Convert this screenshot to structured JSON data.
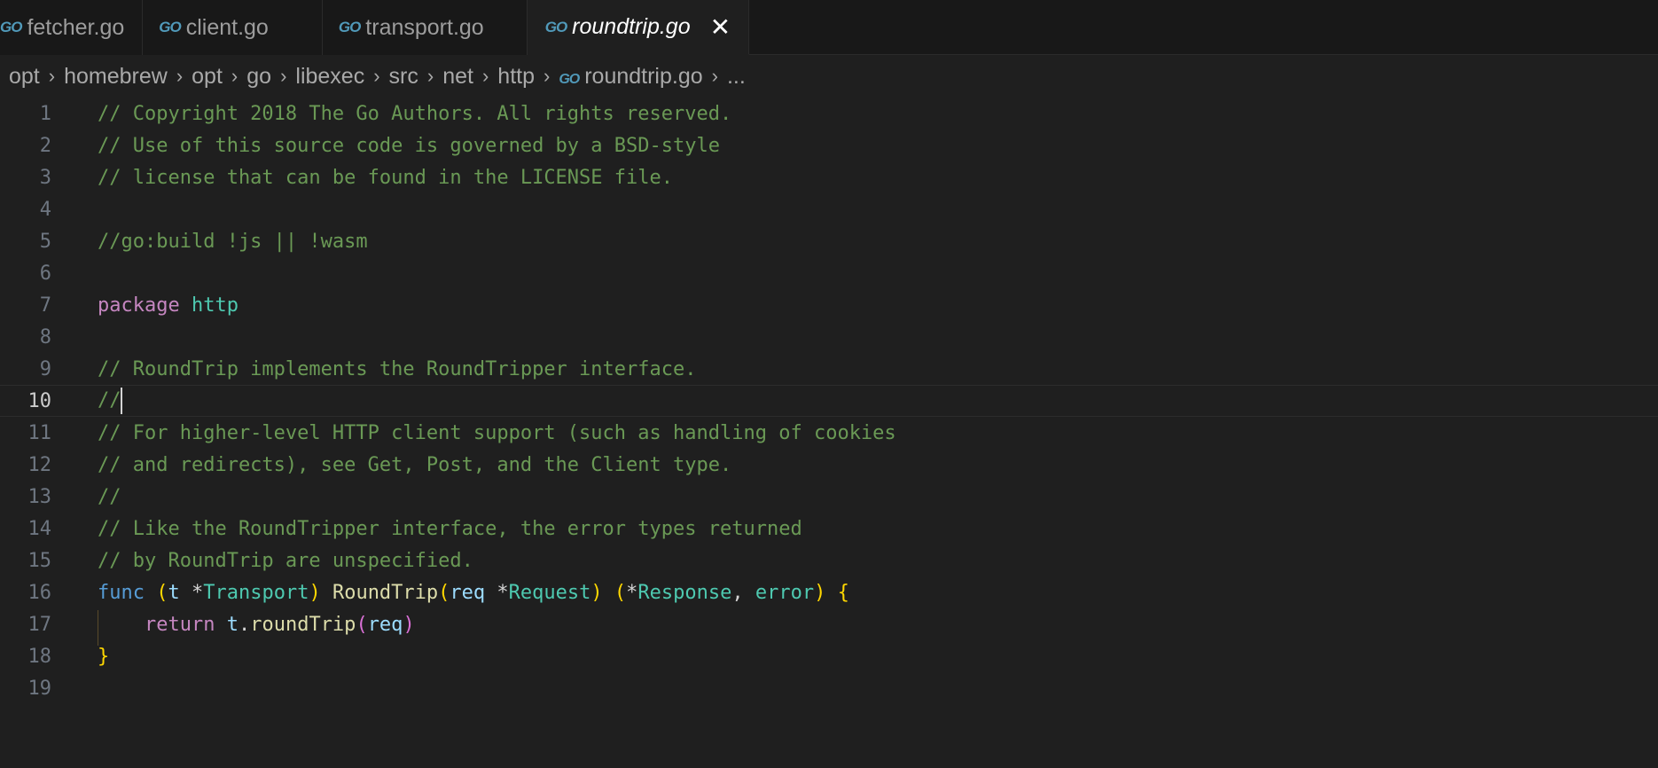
{
  "tabs": [
    {
      "icon": "GO",
      "label": "fetcher.go"
    },
    {
      "icon": "GO",
      "label": "client.go"
    },
    {
      "icon": "GO",
      "label": "transport.go"
    },
    {
      "icon": "GO",
      "label": "roundtrip.go",
      "close": "✕"
    }
  ],
  "breadcrumb": {
    "items": [
      "opt",
      "homebrew",
      "opt",
      "go",
      "libexec",
      "src",
      "net",
      "http"
    ],
    "file_icon": "GO",
    "file": "roundtrip.go",
    "more": "...",
    "separator": "›"
  },
  "editor": {
    "current_line": 10,
    "lines": [
      {
        "n": "1",
        "text": "// Copyright 2018 The Go Authors. All rights reserved."
      },
      {
        "n": "2",
        "text": "// Use of this source code is governed by a BSD-style"
      },
      {
        "n": "3",
        "text": "// license that can be found in the LICENSE file."
      },
      {
        "n": "4",
        "text": ""
      },
      {
        "n": "5",
        "text": "//go:build !js || !wasm"
      },
      {
        "n": "6",
        "text": ""
      },
      {
        "n": "7",
        "kw": "package",
        "name": "http"
      },
      {
        "n": "8",
        "text": ""
      },
      {
        "n": "9",
        "text": "// RoundTrip implements the RoundTripper interface."
      },
      {
        "n": "10",
        "text": "//"
      },
      {
        "n": "11",
        "text": "// For higher-level HTTP client support (such as handling of cookies"
      },
      {
        "n": "12",
        "text": "// and redirects), see Get, Post, and the Client type."
      },
      {
        "n": "13",
        "text": "//"
      },
      {
        "n": "14",
        "text": "// Like the RoundTripper interface, the error types returned"
      },
      {
        "n": "15",
        "text": "// by RoundTrip are unspecified."
      },
      {
        "n": "16",
        "tokens": [
          "func",
          "(",
          "t",
          "*",
          "Transport",
          ")",
          "RoundTrip",
          "(",
          "req",
          "*",
          "Request",
          ")",
          "(",
          "*",
          "Response",
          ",",
          "error",
          ")",
          "{"
        ]
      },
      {
        "n": "17",
        "tokens": [
          "return",
          "t",
          ".",
          "roundTrip",
          "(",
          "req",
          ")"
        ]
      },
      {
        "n": "18",
        "tokens": [
          "}"
        ]
      },
      {
        "n": "19",
        "text": ""
      }
    ]
  },
  "colors": {
    "background": "#1f1f1f",
    "comment": "#6a9955",
    "keyword": "#c586c0",
    "type": "#4ec9b0",
    "function": "#dcdcaa",
    "variable": "#9cdcfe",
    "bracket": "#ffd700",
    "go_icon": "#519aba"
  }
}
